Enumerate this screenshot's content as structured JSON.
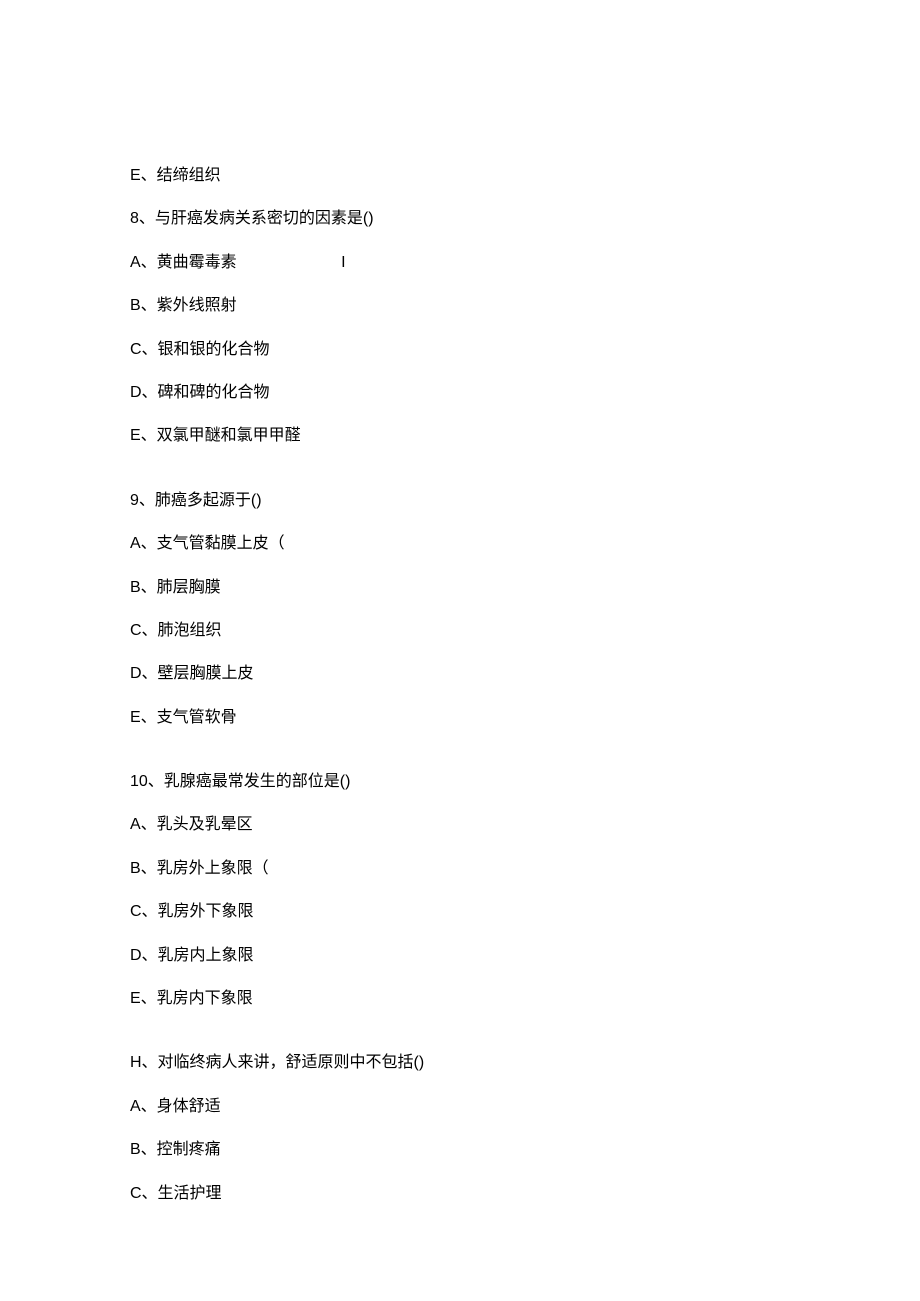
{
  "lines": [
    "E、结缔组织",
    "8、与肝癌发病关系密切的因素是()",
    "A、黄曲霉毒素",
    "B、紫外线照射",
    "C、银和银的化合物",
    "D、碑和碑的化合物",
    "E、双氯甲醚和氯甲甲醛"
  ],
  "line3_extra": "I",
  "q9": {
    "stem": "9、肺癌多起源于()",
    "options": [
      "A、支气管黏膜上皮（",
      "B、肺层胸膜",
      "C、肺泡组织",
      "D、壁层胸膜上皮",
      "E、支气管软骨"
    ]
  },
  "q10": {
    "stem": "10、乳腺癌最常发生的部位是()",
    "options": [
      "A、乳头及乳晕区",
      "B、乳房外上象限（",
      "C、乳房外下象限",
      "D、乳房内上象限",
      "E、乳房内下象限"
    ]
  },
  "qH": {
    "stem": "H、对临终病人来讲，舒适原则中不包括()",
    "options": [
      "A、身体舒适",
      "B、控制疼痛",
      "C、生活护理"
    ]
  }
}
